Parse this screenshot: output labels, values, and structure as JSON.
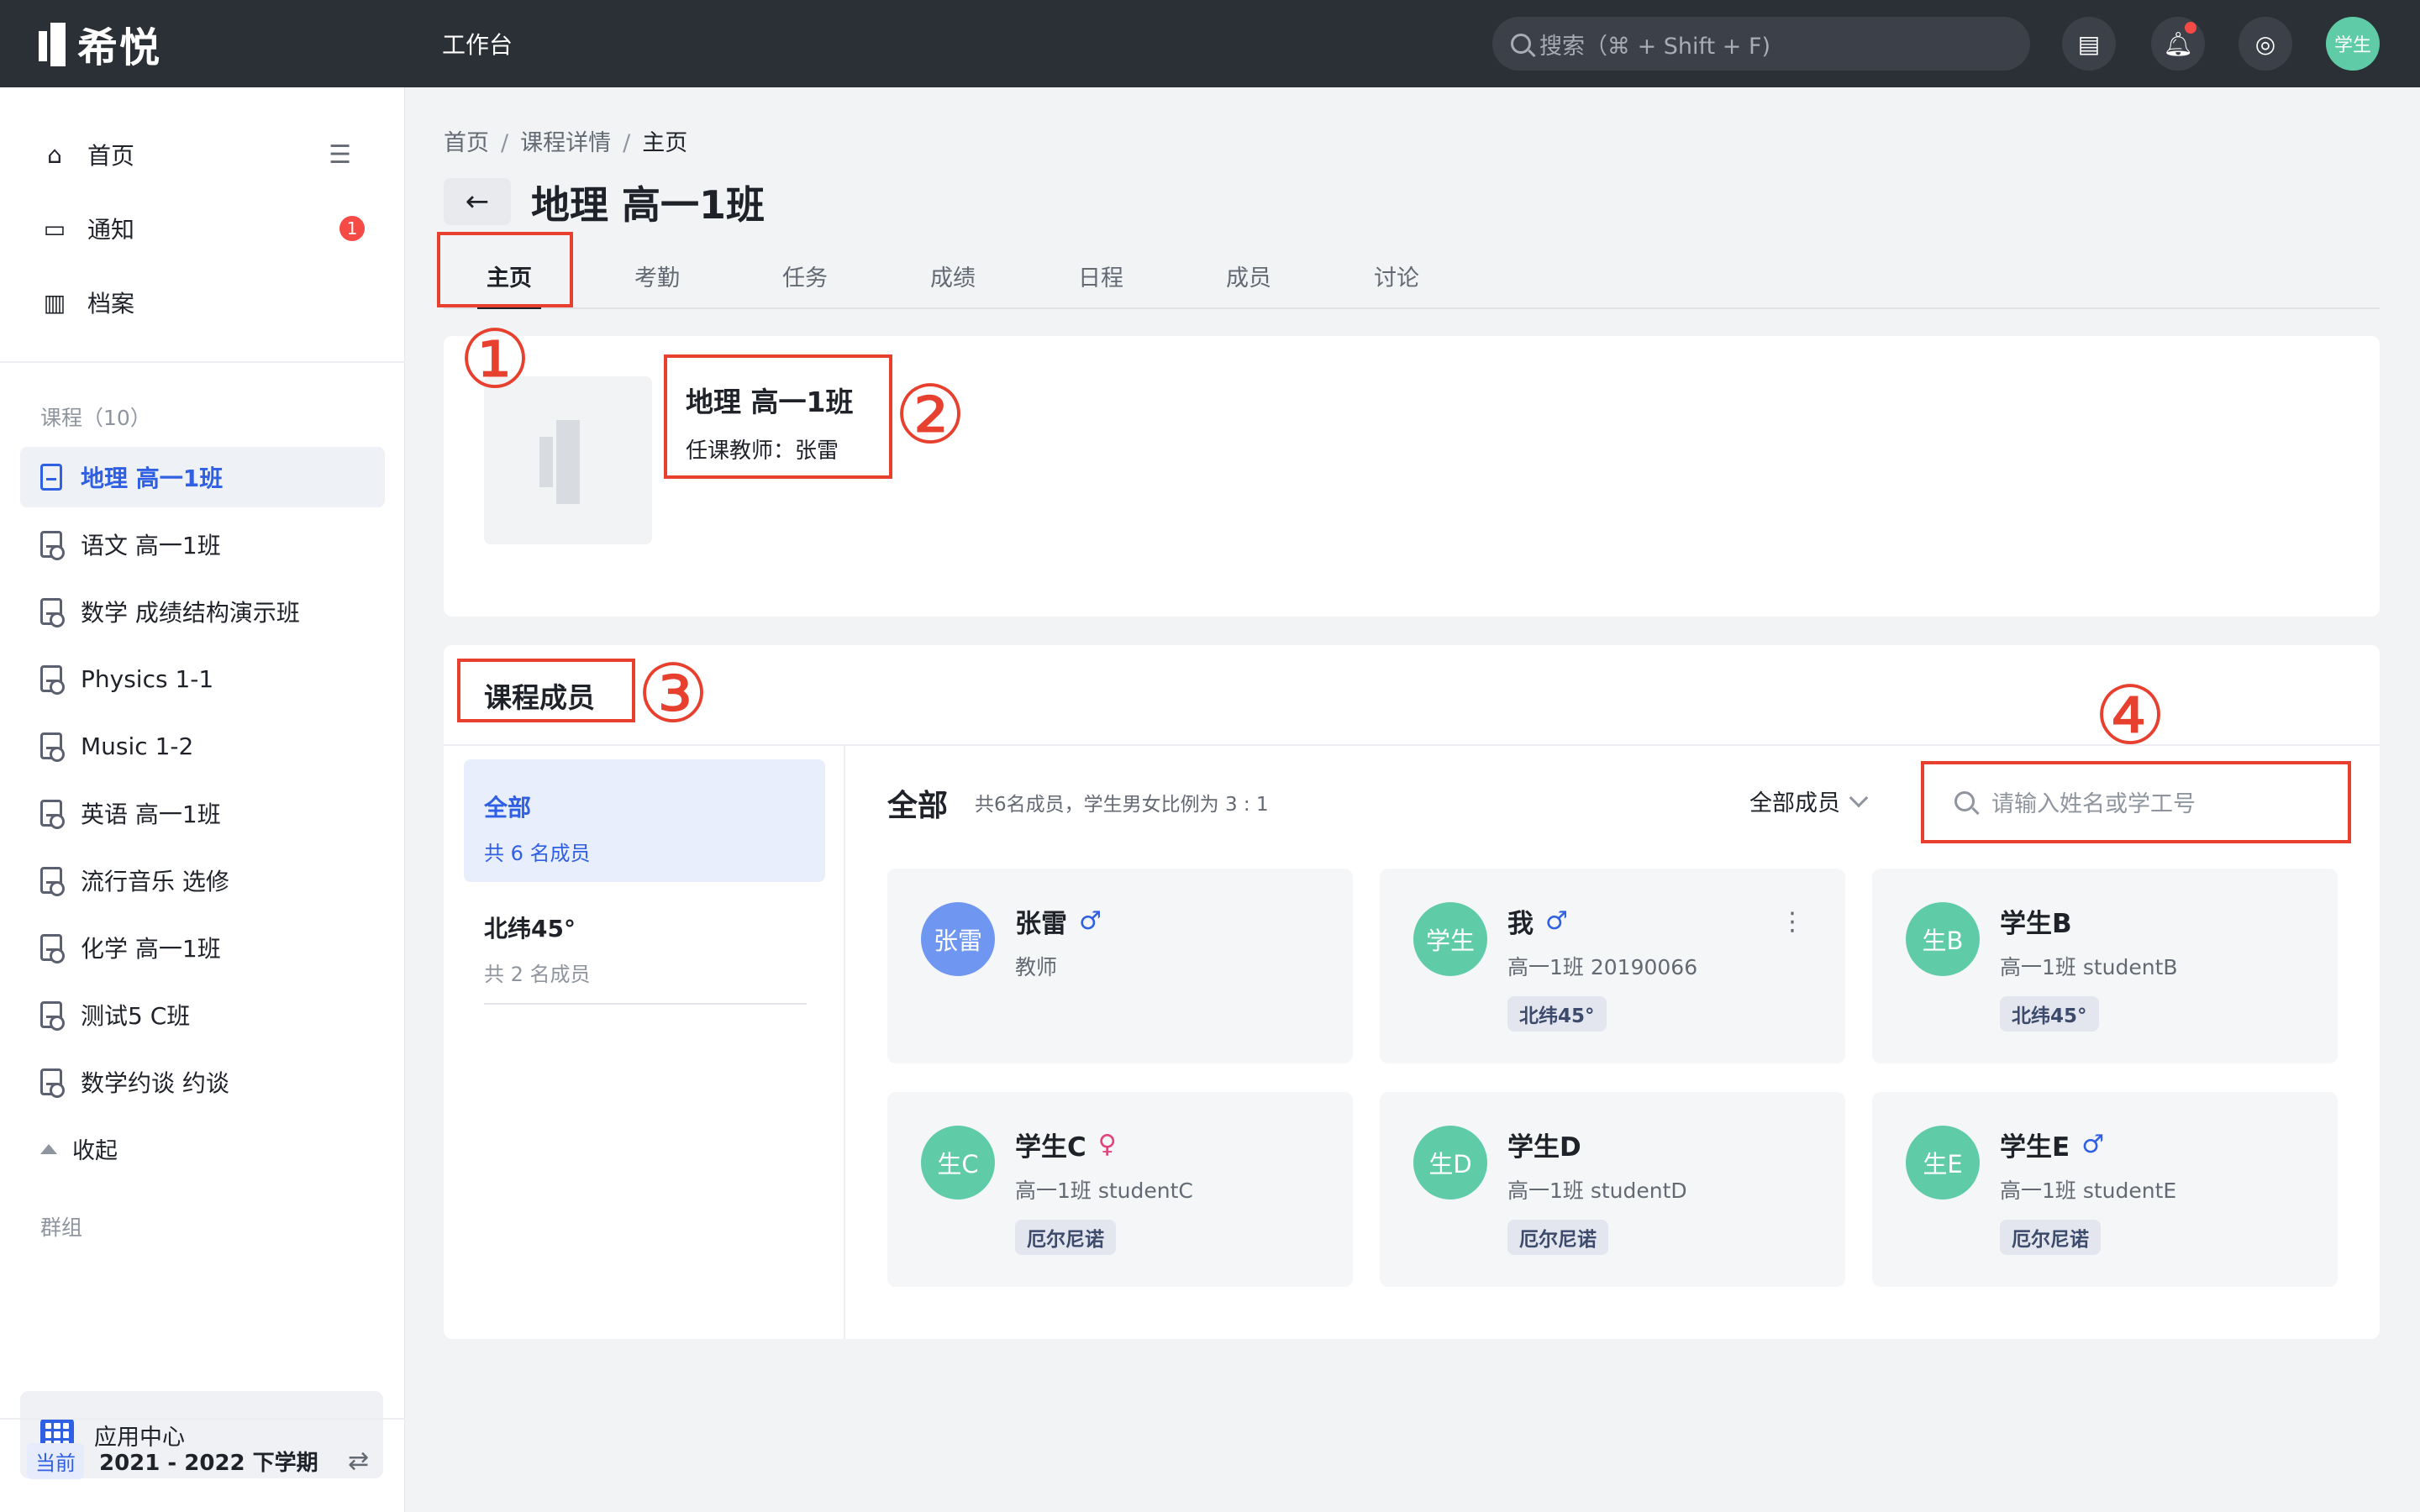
{
  "topbar": {
    "logo_text": "希悦",
    "workbench": "工作台",
    "search_placeholder": "搜索（⌘ + Shift + F)",
    "avatar_text": "学生"
  },
  "sidebar": {
    "nav": [
      {
        "label": "首页",
        "icon": "home-icon"
      },
      {
        "label": "通知",
        "icon": "message-icon",
        "badge": "1"
      },
      {
        "label": "档案",
        "icon": "archive-icon"
      }
    ],
    "courses_label": "课程（10）",
    "courses": [
      "地理 高一1班",
      "语文 高一1班",
      "数学 成绩结构演示班",
      "Physics 1-1",
      "Music 1-2",
      "英语 高一1班",
      "流行音乐 选修",
      "化学 高一1班",
      "测试5 C班",
      "数学约谈 约谈"
    ],
    "fold_label": "收起",
    "groups_label": "群组",
    "app_center": "应用中心",
    "term_badge": "当前",
    "term": "2021 - 2022 下学期"
  },
  "main": {
    "breadcrumb": [
      "首页",
      "课程详情",
      "主页"
    ],
    "title": "地理 高一1班",
    "tabs": [
      "主页",
      "考勤",
      "任务",
      "成绩",
      "日程",
      "成员",
      "讨论"
    ],
    "course_name": "地理 高一1班",
    "teacher": "任课教师：张雷",
    "members_title": "课程成员",
    "groups": [
      {
        "name": "全部",
        "count": "共 6 名成员"
      },
      {
        "name": "北纬45°",
        "count": "共 2 名成员"
      }
    ],
    "list_title": "全部",
    "ratio_text": "共6名成员，学生男女比例为 3 : 1",
    "filter_label": "全部成员",
    "search_placeholder": "请输入姓名或学工号",
    "members": [
      {
        "avatar": "张雷",
        "name": "张雷",
        "gender": "♂",
        "desc": "教师",
        "tag": ""
      },
      {
        "avatar": "学生",
        "name": "我",
        "gender": "♂",
        "desc": "高一1班 20190066",
        "tag": "北纬45°"
      },
      {
        "avatar": "生B",
        "name": "学生B",
        "gender": "",
        "desc": "高一1班 studentB",
        "tag": "北纬45°"
      },
      {
        "avatar": "生C",
        "name": "学生C",
        "gender": "♀",
        "desc": "高一1班 studentC",
        "tag": "厄尔尼诺"
      },
      {
        "avatar": "生D",
        "name": "学生D",
        "gender": "",
        "desc": "高一1班 studentD",
        "tag": "厄尔尼诺"
      },
      {
        "avatar": "生E",
        "name": "学生E",
        "gender": "♂",
        "desc": "高一1班 studentE",
        "tag": "厄尔尼诺"
      }
    ],
    "annotations": [
      "①",
      "②",
      "③",
      "④"
    ]
  },
  "colors": {
    "accent": "#2f5fe3",
    "topbar": "#2b2f36",
    "annotation_red": "#e8402f",
    "avatar_green": "#5fcca7",
    "avatar_blue": "#6f97f2"
  }
}
